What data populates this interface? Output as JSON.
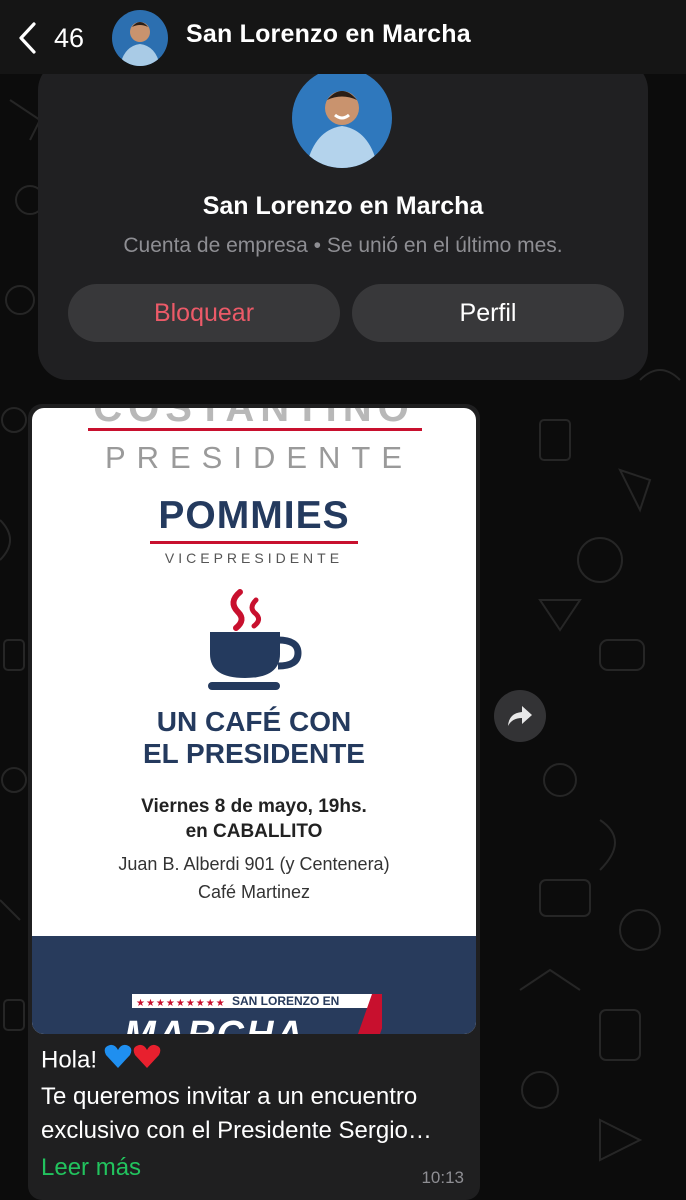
{
  "header": {
    "back_count": "46",
    "title": "San Lorenzo en Marcha"
  },
  "info_card": {
    "name": "San Lorenzo en Marcha",
    "subtitle": "Cuenta de empresa • Se unió en el último mes.",
    "block_label": "Bloquear",
    "profile_label": "Perfil"
  },
  "message": {
    "flyer": {
      "top_text": "COSTANTINO",
      "president": "PRESIDENTE",
      "vice_name": "POMMIES",
      "vice_title": "VICEPRESIDENTE",
      "title_line1": "UN CAFÉ CON",
      "title_line2": "EL PRESIDENTE",
      "date_line1": "Viernes 8 de mayo, 19hs.",
      "date_line2": "en CABALLITO",
      "address_line1": "Juan B. Alberdi 901 (y Centenera)",
      "address_line2": "Café Martinez",
      "footer_label": "SAN LORENZO EN",
      "footer_big": "MARCHA"
    },
    "text_line1": "Hola!",
    "text_line2": "Te queremos invitar a un encuentro exclusivo con el Presidente Sergio…",
    "read_more": "Leer más",
    "time": "10:13"
  },
  "colors": {
    "block_red": "#ec5a68",
    "read_more_green": "#22c35e",
    "flyer_navy": "#243a5e",
    "flyer_red": "#c8102e"
  }
}
